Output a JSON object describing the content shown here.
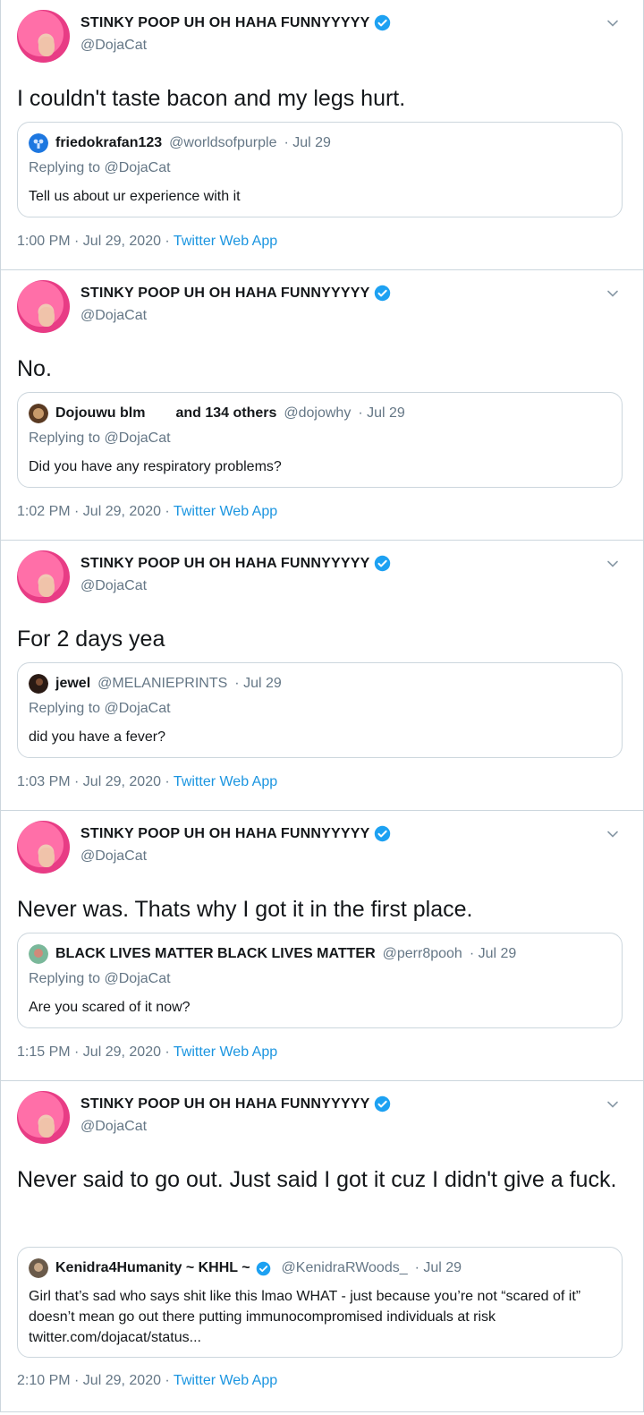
{
  "author": {
    "name": "STINKY POOP UH OH HAHA FUNNYYYYY",
    "handle": "@DojaCat"
  },
  "tweets": [
    {
      "text": "I couldn't taste bacon and my legs hurt.",
      "quote": {
        "name": "friedokrafan123",
        "handle": "@worldsofpurple",
        "date": "· Jul 29",
        "replying": "Replying to @DojaCat",
        "body": "Tell us about ur experience with it"
      },
      "time": "1:00 PM · Jul 29, 2020 · ",
      "app": "Twitter Web App"
    },
    {
      "text": "No.",
      "quote": {
        "name": "Dojouwu blm",
        "extra": "and 134 others",
        "handle": "@dojowhy",
        "date": "· Jul 29",
        "replying": "Replying to @DojaCat",
        "body": "Did you have any respiratory problems?"
      },
      "time": "1:02 PM · Jul 29, 2020 · ",
      "app": "Twitter Web App"
    },
    {
      "text": "For 2 days yea",
      "quote": {
        "name": "jewel",
        "handle": "@MELANIEPRINTS",
        "date": "· Jul 29",
        "replying": "Replying to @DojaCat",
        "body": "did you have a fever?"
      },
      "time": "1:03 PM · Jul 29, 2020 · ",
      "app": "Twitter Web App"
    },
    {
      "text": "Never was. Thats why I got it in the first place.",
      "quote": {
        "name": "BLACK LIVES MATTER BLACK LIVES MATTER",
        "handle": "@perr8pooh",
        "date": "· Jul 29",
        "replying": "Replying to @DojaCat",
        "body": "Are you scared of it now?"
      },
      "time": "1:15 PM · Jul 29, 2020 · ",
      "app": "Twitter Web App"
    },
    {
      "text": "Never said to go out. Just said I got it cuz I didn't give a fuck.",
      "quote": {
        "name": "Kenidra4Humanity ~ KHHL ~",
        "handle": "@KenidraRWoods_",
        "date": "· Jul 29",
        "body": "Girl that’s sad who says shit like this lmao WHAT - just because you’re not “scared of it” doesn’t mean go out there putting immunocompromised individuals at risk twitter.com/dojacat/status..."
      },
      "time": "2:10 PM · Jul 29, 2020 · ",
      "app": "Twitter Web App"
    }
  ],
  "colors": {
    "accent": "#1b95e0",
    "verified": "#1da1f2",
    "muted": "#657786",
    "border": "#ccd6dd"
  }
}
